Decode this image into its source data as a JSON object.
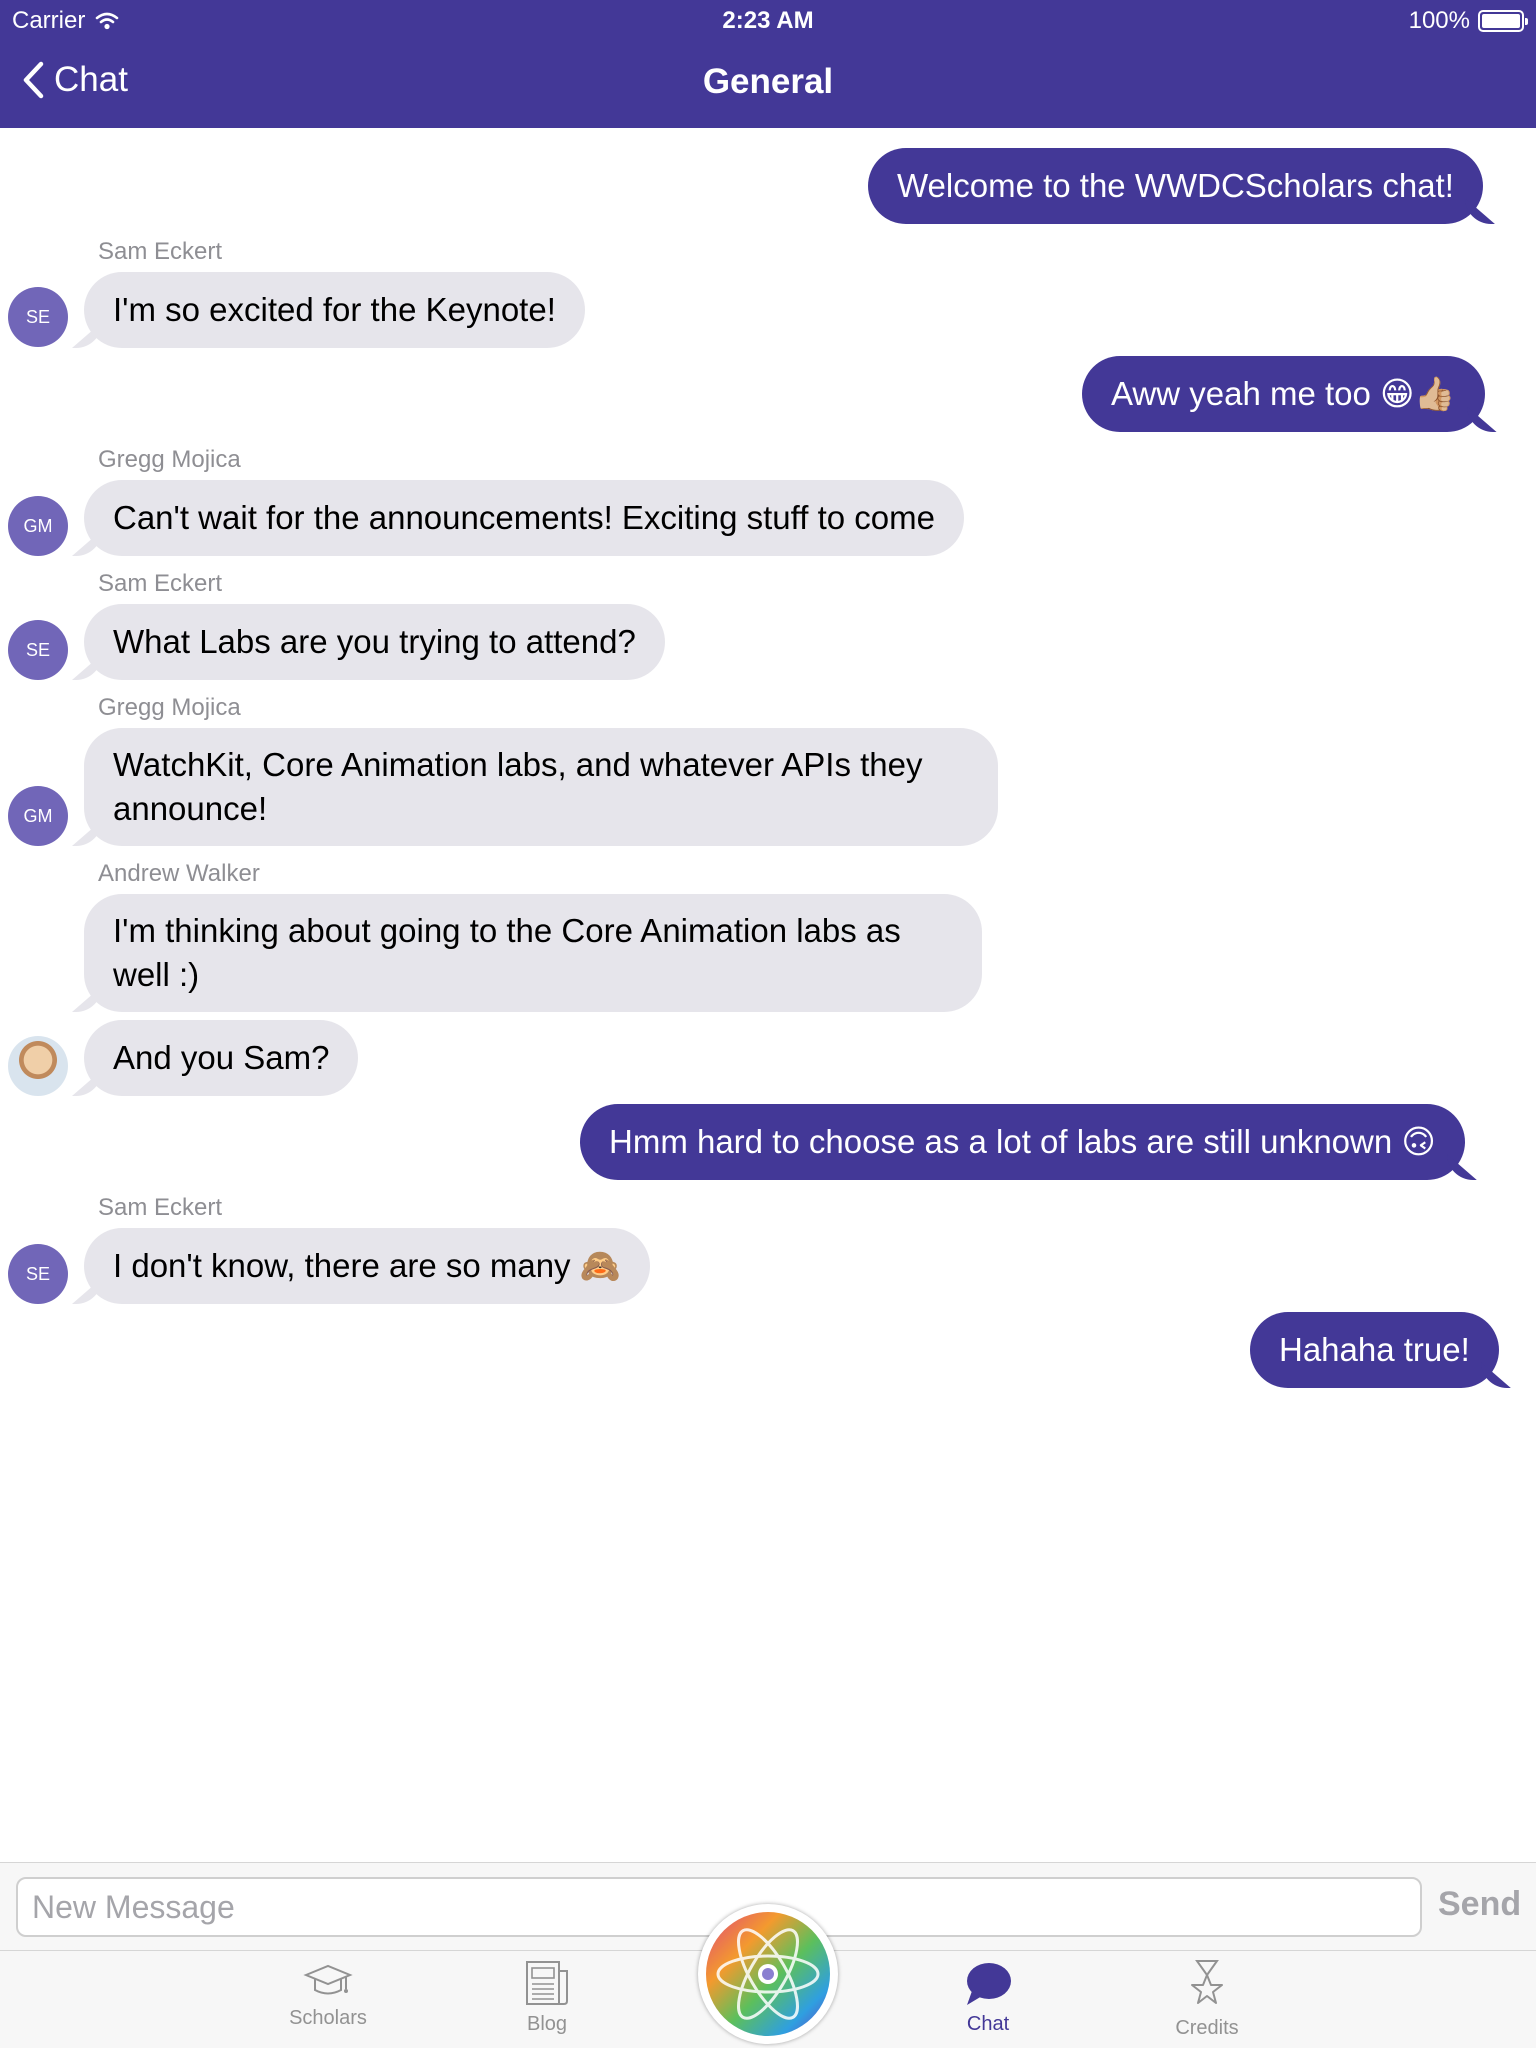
{
  "status_bar": {
    "carrier": "Carrier",
    "time": "2:23 AM",
    "battery": "100%"
  },
  "nav": {
    "back_label": "Chat",
    "title": "General"
  },
  "colors": {
    "brand": "#433897",
    "incoming_bubble": "#e6e5eb",
    "avatar": "#7166b8"
  },
  "messages": [
    {
      "direction": "out",
      "text": "Welcome to the WWDCScholars chat!"
    },
    {
      "direction": "in",
      "sender": "Sam Eckert",
      "initials": "SE",
      "text": "I'm so excited for the Keynote!"
    },
    {
      "direction": "out",
      "text": "Aww yeah me too 😁👍🏼"
    },
    {
      "direction": "in",
      "sender": "Gregg Mojica",
      "initials": "GM",
      "text": "Can't wait for the announcements! Exciting stuff to come"
    },
    {
      "direction": "in",
      "sender": "Sam Eckert",
      "initials": "SE",
      "text": "What Labs are you trying to attend?"
    },
    {
      "direction": "in",
      "sender": "Gregg Mojica",
      "initials": "GM",
      "text": "WatchKit, Core Animation labs, and whatever APIs they announce!"
    },
    {
      "direction": "in",
      "sender": "Andrew Walker",
      "text": "I'm thinking about going to the Core Animation labs as well :)"
    },
    {
      "direction": "in",
      "avatar": "photo",
      "text": "And you Sam?"
    },
    {
      "direction": "out",
      "text": "Hmm hard to choose as a lot of labs are still unknown 🙃"
    },
    {
      "direction": "in",
      "sender": "Sam Eckert",
      "initials": "SE",
      "text": "I don't know, there are so many 🙈"
    },
    {
      "direction": "out",
      "text": "Hahaha true!"
    }
  ],
  "composer": {
    "placeholder": "New Message",
    "send_label": "Send"
  },
  "tabs": [
    {
      "label": "Scholars",
      "icon": "graduation-cap-icon"
    },
    {
      "label": "Blog",
      "icon": "newspaper-icon"
    },
    {
      "label": "Chat",
      "icon": "chat-bubble-icon",
      "active": true
    },
    {
      "label": "Credits",
      "icon": "star-trophy-icon"
    }
  ],
  "center_button": {
    "icon": "atom-logo-icon"
  }
}
